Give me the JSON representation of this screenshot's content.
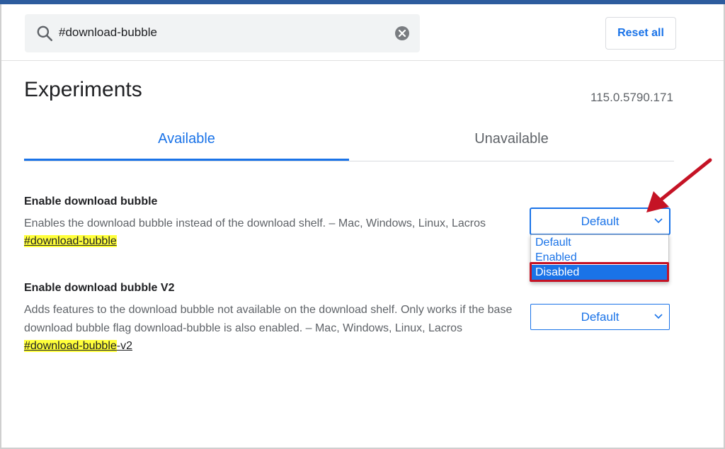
{
  "search": {
    "query": "#download-bubble",
    "icon": "search-icon",
    "clear_icon": "clear-icon"
  },
  "header": {
    "reset_label": "Reset all"
  },
  "page": {
    "title": "Experiments",
    "version": "115.0.5790.171"
  },
  "tabs": [
    {
      "label": "Available",
      "active": true
    },
    {
      "label": "Unavailable",
      "active": false
    }
  ],
  "experiments": [
    {
      "title": "Enable download bubble",
      "description": "Enables the download bubble instead of the download shelf. – Mac, Windows, Linux, Lacros",
      "tag_highlight": "#download-bubble",
      "tag_suffix": "",
      "select_value": "Default",
      "dropdown_open": true,
      "options": [
        "Default",
        "Enabled",
        "Disabled"
      ],
      "hovered_option": "Disabled"
    },
    {
      "title": "Enable download bubble V2",
      "description": "Adds features to the download bubble not available on the download shelf. Only works if the base download bubble flag download-bubble is also enabled. – Mac, Windows, Linux, Lacros",
      "tag_highlight": "#download-bubble",
      "tag_suffix": "-v2",
      "select_value": "Default"
    }
  ],
  "colors": {
    "accent": "#1a73e8",
    "top_bar": "#2d5c9e",
    "highlight": "#ffff3a",
    "annotation": "#c51325"
  }
}
